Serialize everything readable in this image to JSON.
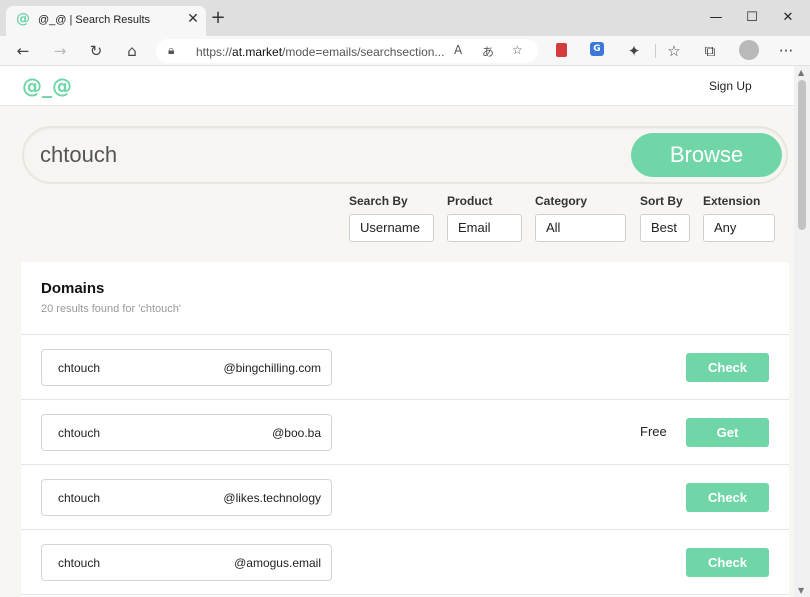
{
  "browser": {
    "tab_favicon": "@",
    "tab_title": "@_@ | Search Results",
    "tab_close": "✕",
    "new_tab": "+",
    "window_minimize": "—",
    "window_maximize": "☐",
    "window_close": "✕",
    "back_icon": "←",
    "forward_icon": "→",
    "reload_icon": "↻",
    "home_icon": "⌂",
    "url_scheme": "https://",
    "url_host": "at.market",
    "url_path": "/mode=emails/searchsection...",
    "read_aloud_icon": "A",
    "translate_icon": "あ",
    "favorite_icon": "☆",
    "extension_blue_label": "G",
    "extensions_icon": "✦",
    "favorites_bar_icon": "☆",
    "collections_icon": "⧉",
    "more_icon": "···"
  },
  "site": {
    "logo": "@_@",
    "signup_label": "Sign Up"
  },
  "search": {
    "query": "chtouch",
    "browse_label": "Browse"
  },
  "filters": [
    {
      "label": "Search By",
      "value": "Username"
    },
    {
      "label": "Product",
      "value": "Email"
    },
    {
      "label": "Category",
      "value": "All"
    },
    {
      "label": "Sort By",
      "value": "Best"
    },
    {
      "label": "Extension",
      "value": "Any"
    }
  ],
  "results": {
    "title": "Domains",
    "subtitle": "20 results found for 'chtouch'",
    "rows": [
      {
        "user": "chtouch",
        "domain": "@bingchilling.com",
        "price": "",
        "action": "Check"
      },
      {
        "user": "chtouch",
        "domain": "@boo.ba",
        "price": "Free",
        "action": "Get"
      },
      {
        "user": "chtouch",
        "domain": "@likes.technology",
        "price": "",
        "action": "Check"
      },
      {
        "user": "chtouch",
        "domain": "@amogus.email",
        "price": "",
        "action": "Check"
      }
    ]
  },
  "colors": {
    "accent": "#70d6a8",
    "logo": "#6dd5a8",
    "page_background": "#f7f6f3"
  }
}
